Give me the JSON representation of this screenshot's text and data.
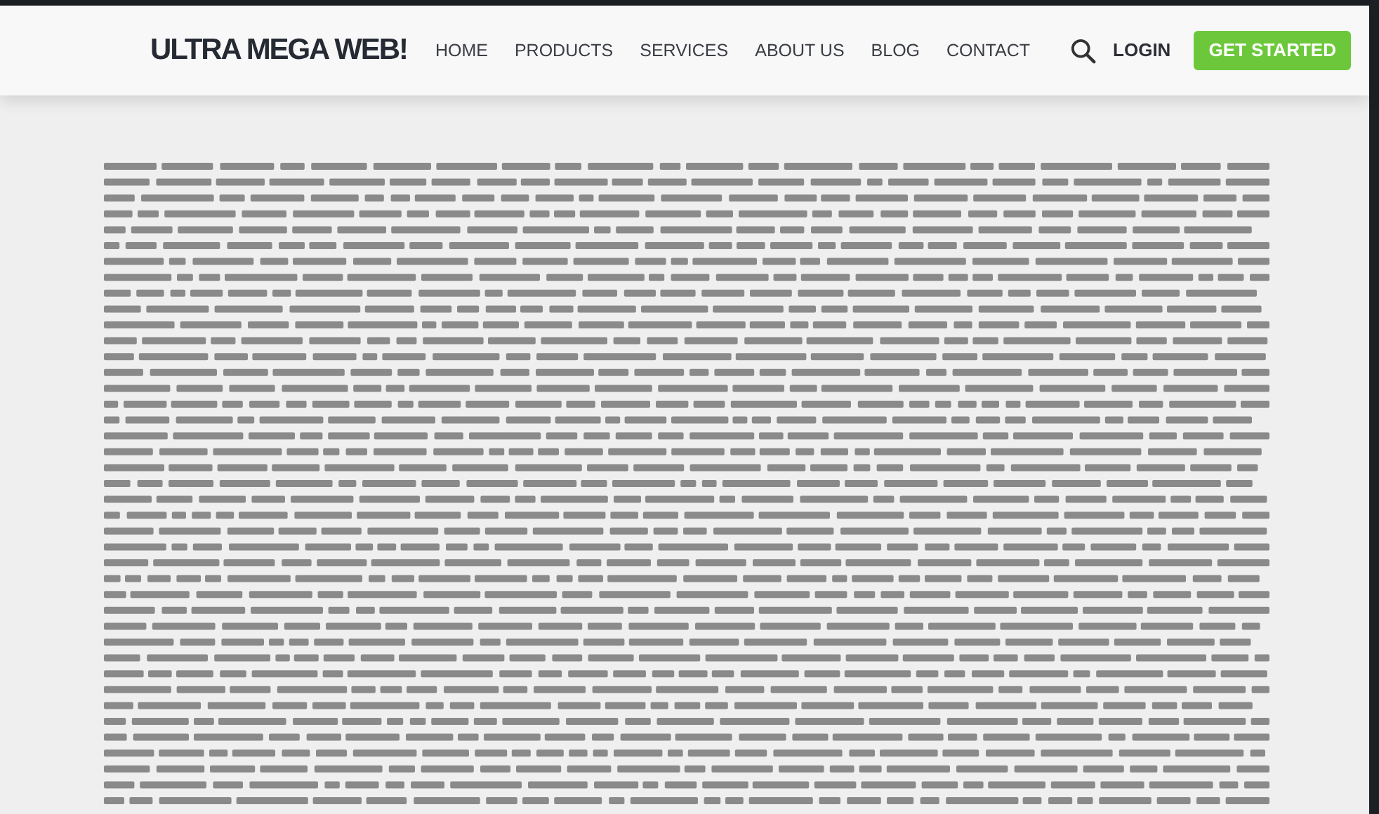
{
  "header": {
    "logo": "ULTRA MEGA WEB!",
    "nav": [
      {
        "label": "HOME"
      },
      {
        "label": "PRODUCTS"
      },
      {
        "label": "SERVICES"
      },
      {
        "label": "ABOUT US"
      },
      {
        "label": "BLOG"
      },
      {
        "label": "CONTACT"
      }
    ],
    "login": "LOGIN",
    "cta": "GET STARTED"
  }
}
